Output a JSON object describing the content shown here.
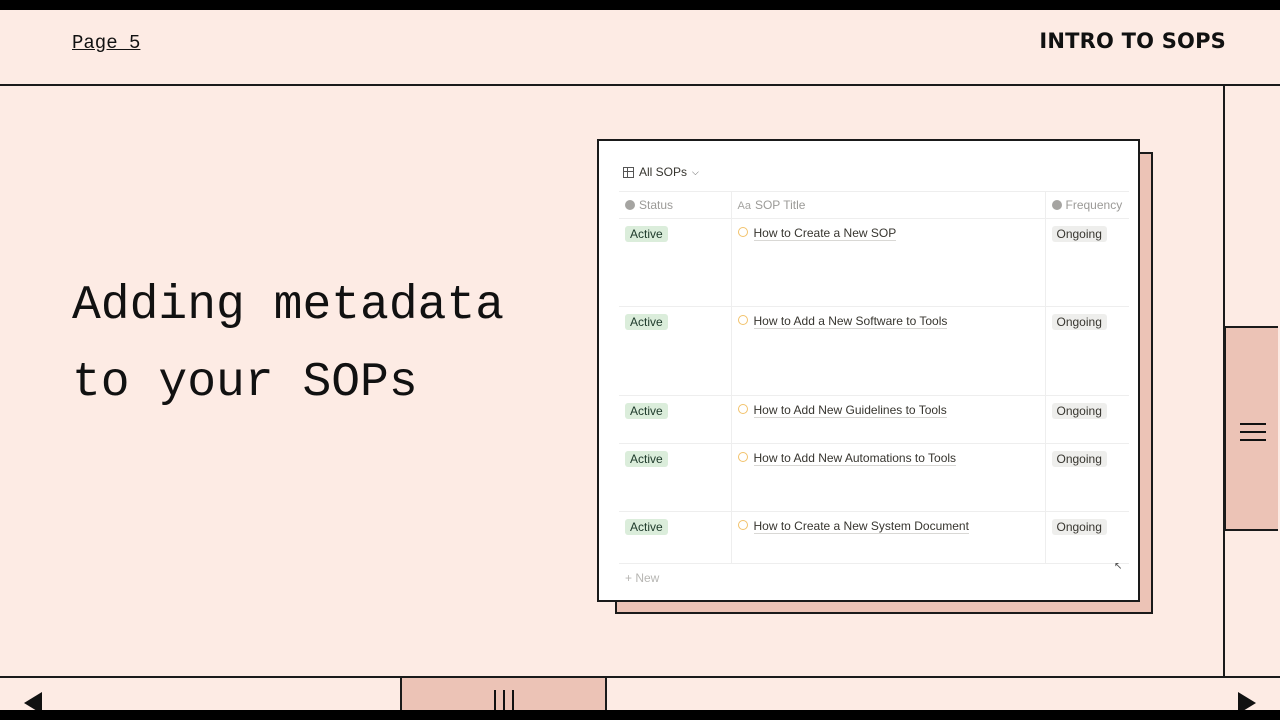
{
  "header": {
    "page_label": "Page 5",
    "deck_title": "INTRO TO SOPS"
  },
  "slide": {
    "headline_line1": "Adding metadata",
    "headline_line2": "to your SOPs"
  },
  "screenshot": {
    "view_name": "All SOPs",
    "columns": [
      "Status",
      "SOP Title",
      "Frequency"
    ],
    "rows": [
      {
        "status": "Active",
        "title": "How to Create a New SOP",
        "frequency": "Ongoing"
      },
      {
        "status": "Active",
        "title": "How to Add a New Software to Tools",
        "frequency": "Ongoing"
      },
      {
        "status": "Active",
        "title": "How to Add New Guidelines to Tools",
        "frequency": "Ongoing"
      },
      {
        "status": "Active",
        "title": "How to Add New Automations to Tools",
        "frequency": "Ongoing"
      },
      {
        "status": "Active",
        "title": "How to Create a New System Document",
        "frequency": "Ongoing"
      }
    ],
    "new_label": "+ New"
  },
  "icons": {
    "menu": "hamburger-menu-icon",
    "prev": "arrow-left-icon",
    "next": "arrow-right-icon",
    "slider": "bars-icon"
  },
  "colors": {
    "background": "#fdebe4",
    "accent": "#ecc3b6",
    "ink": "#111111"
  }
}
